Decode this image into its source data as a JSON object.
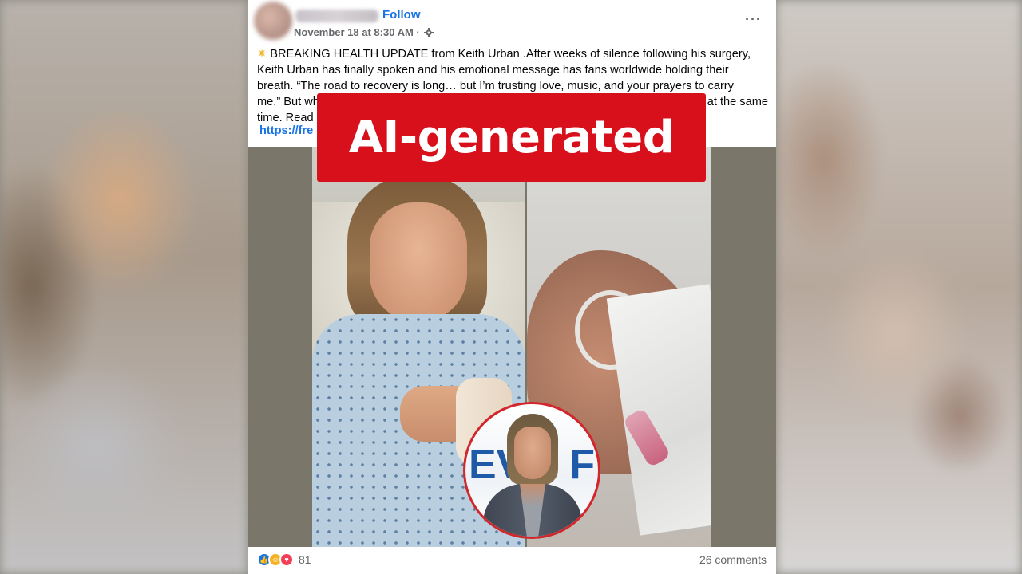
{
  "post": {
    "follow_label": "Follow",
    "date": "November 18 at 8:30 AM · ",
    "more_icon": "···",
    "headline_icon": "sun-emoji",
    "text_line1": "BREAKING HEALTH UPDATE from Keith Urban .After weeks of silence following his surgery,",
    "text_line2": "Keith Urban has finally spoken and his emotional message has fans worldwide holding their",
    "text_line3": "breath. “The road to recovery is long… but I’m trusting love, music, and your prayers to carry",
    "text_line4": "me.” But wh",
    "text_line4_end": "at the same",
    "text_line5": "time. Read",
    "link_text": "https://fre",
    "inset_letters_left": "EV",
    "inset_letters_right": "F"
  },
  "label": {
    "text": "AI-generated",
    "color": "#d7101c"
  },
  "footer": {
    "reaction_icons": [
      "like-icon",
      "care-icon",
      "love-icon"
    ],
    "reaction_count": "81",
    "comments": "26 comments"
  }
}
